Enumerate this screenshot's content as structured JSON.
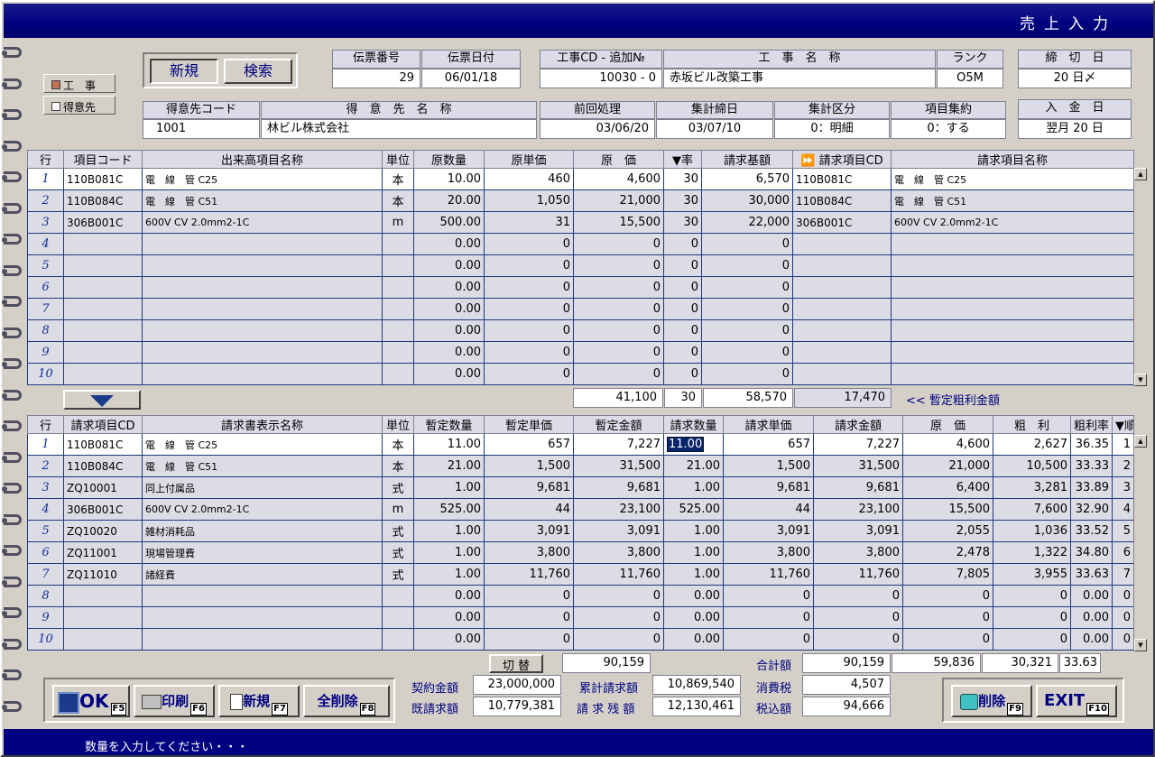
{
  "title": "売上入力",
  "status": "数量を入力してください・・・",
  "mode": {
    "kouji": "工　事",
    "tokuisaki": "得意先"
  },
  "actions": {
    "new": "新規",
    "search": "検索"
  },
  "header": {
    "denpyo_no_label": "伝票番号",
    "denpyo_no": "29",
    "denpyo_date_label": "伝票日付",
    "denpyo_date": "06/01/18",
    "kouji_cd_label": "工事CD - 追加№",
    "kouji_cd": "10030 - 0",
    "kouji_name_label": "工　事　名　称",
    "kouji_name": "赤坂ビル改築工事",
    "rank_label": "ランク",
    "rank": "O5M",
    "shime_label": "締　切　日",
    "shime": "20 日〆",
    "tokui_cd_label": "得意先コード",
    "tokui_cd": "1001",
    "tokui_name_label": "得　意　先　名　称",
    "tokui_name": "林ビル株式会社",
    "zenkai_label": "前回処理",
    "zenkai": "03/06/20",
    "shukei_label": "集計締日",
    "shukei": "03/07/10",
    "kubun_label": "集計区分",
    "kubun": "0：明細",
    "shuyaku_label": "項目集約",
    "shuyaku": "0：する",
    "nyukin_label": "入　金　日",
    "nyukin": "翌月 20 日"
  },
  "grid1": {
    "headers": [
      "行",
      "項目コード",
      "出来高項目名称",
      "単位",
      "原数量",
      "原単価",
      "原　価",
      "▼率",
      "請求基額",
      "⏩ 請求項目CD",
      "請求項目名称"
    ],
    "rows": [
      [
        "1",
        "110B081C",
        "電　線　管 C25",
        "本",
        "10.00",
        "460",
        "4,600",
        "30",
        "6,570",
        "110B081C",
        "電　線　管 C25"
      ],
      [
        "2",
        "110B084C",
        "電　線　管 C51",
        "本",
        "20.00",
        "1,050",
        "21,000",
        "30",
        "30,000",
        "110B084C",
        "電　線　管 C51"
      ],
      [
        "3",
        "306B001C",
        "600V CV 2.0mm2-1C",
        "m",
        "500.00",
        "31",
        "15,500",
        "30",
        "22,000",
        "306B001C",
        "600V CV 2.0mm2-1C"
      ],
      [
        "4",
        "",
        "",
        "",
        "0.00",
        "0",
        "0",
        "0",
        "0",
        "",
        ""
      ],
      [
        "5",
        "",
        "",
        "",
        "0.00",
        "0",
        "0",
        "0",
        "0",
        "",
        ""
      ],
      [
        "6",
        "",
        "",
        "",
        "0.00",
        "0",
        "0",
        "0",
        "0",
        "",
        ""
      ],
      [
        "7",
        "",
        "",
        "",
        "0.00",
        "0",
        "0",
        "0",
        "0",
        "",
        ""
      ],
      [
        "8",
        "",
        "",
        "",
        "0.00",
        "0",
        "0",
        "0",
        "0",
        "",
        ""
      ],
      [
        "9",
        "",
        "",
        "",
        "0.00",
        "0",
        "0",
        "0",
        "0",
        "",
        ""
      ],
      [
        "10",
        "",
        "",
        "",
        "0.00",
        "0",
        "0",
        "0",
        "0",
        "",
        ""
      ]
    ],
    "tot_genka": "41,100",
    "tot_rate": "30",
    "tot_kigaku": "58,570",
    "tot_arari": "17,470",
    "tot_label": "<< 暫定粗利金額"
  },
  "grid2": {
    "headers": [
      "行",
      "請求項目CD",
      "請求書表示名称",
      "単位",
      "暫定数量",
      "暫定単価",
      "暫定金額",
      "請求数量",
      "請求単価",
      "請求金額",
      "原　価",
      "粗　利",
      "粗利率",
      "▼順"
    ],
    "rows": [
      [
        "1",
        "110B081C",
        "電　線　管 C25",
        "本",
        "11.00",
        "657",
        "7,227",
        "11.00",
        "657",
        "7,227",
        "4,600",
        "2,627",
        "36.35",
        "1"
      ],
      [
        "2",
        "110B084C",
        "電　線　管 C51",
        "本",
        "21.00",
        "1,500",
        "31,500",
        "21.00",
        "1,500",
        "31,500",
        "21,000",
        "10,500",
        "33.33",
        "2"
      ],
      [
        "3",
        "ZQ10001",
        "同上付属品",
        "式",
        "1.00",
        "9,681",
        "9,681",
        "1.00",
        "9,681",
        "9,681",
        "6,400",
        "3,281",
        "33.89",
        "3"
      ],
      [
        "4",
        "306B001C",
        "600V CV 2.0mm2-1C",
        "m",
        "525.00",
        "44",
        "23,100",
        "525.00",
        "44",
        "23,100",
        "15,500",
        "7,600",
        "32.90",
        "4"
      ],
      [
        "5",
        "ZQ10020",
        "雑材消耗品",
        "式",
        "1.00",
        "3,091",
        "3,091",
        "1.00",
        "3,091",
        "3,091",
        "2,055",
        "1,036",
        "33.52",
        "5"
      ],
      [
        "6",
        "ZQ11001",
        "現場管理費",
        "式",
        "1.00",
        "3,800",
        "3,800",
        "1.00",
        "3,800",
        "3,800",
        "2,478",
        "1,322",
        "34.80",
        "6"
      ],
      [
        "7",
        "ZQ11010",
        "諸経費",
        "式",
        "1.00",
        "11,760",
        "11,760",
        "1.00",
        "11,760",
        "11,760",
        "7,805",
        "3,955",
        "33.63",
        "7"
      ],
      [
        "8",
        "",
        "",
        "",
        "0.00",
        "0",
        "0",
        "0.00",
        "0",
        "0",
        "0",
        "0",
        "0.00",
        "0"
      ],
      [
        "9",
        "",
        "",
        "",
        "0.00",
        "0",
        "0",
        "0.00",
        "0",
        "0",
        "0",
        "0",
        "0.00",
        "0"
      ],
      [
        "10",
        "",
        "",
        "",
        "0.00",
        "0",
        "0",
        "0.00",
        "0",
        "0",
        "0",
        "0",
        "0.00",
        "0"
      ]
    ]
  },
  "totals": {
    "kirikae": "切 替",
    "zantei_total": "90,159",
    "goukei_label": "合計額",
    "goukei": "90,159",
    "genka": "59,836",
    "arari": "30,321",
    "rate": "33.63",
    "keiyaku_label": "契約金額",
    "keiyaku": "23,000,000",
    "ruikei_label": "累計請求額",
    "ruikei": "10,869,540",
    "zeigaku_label": "消費税",
    "zei": "4,507",
    "kiseikyu_label": "既請求額",
    "kiseikyu": "10,779,381",
    "zandaka_label": "請 求 残 額",
    "zandaka": "12,130,461",
    "zeikomi_label": "税込額",
    "zeikomi": "94,666"
  },
  "buttons": {
    "ok": "OK",
    "ok_key": "F5",
    "print": "印刷",
    "print_key": "F6",
    "new": "新規",
    "new_key": "F7",
    "alldel": "全削除",
    "alldel_key": "F8",
    "del": "削除",
    "del_key": "F9",
    "exit": "EXIT",
    "exit_key": "F10"
  }
}
